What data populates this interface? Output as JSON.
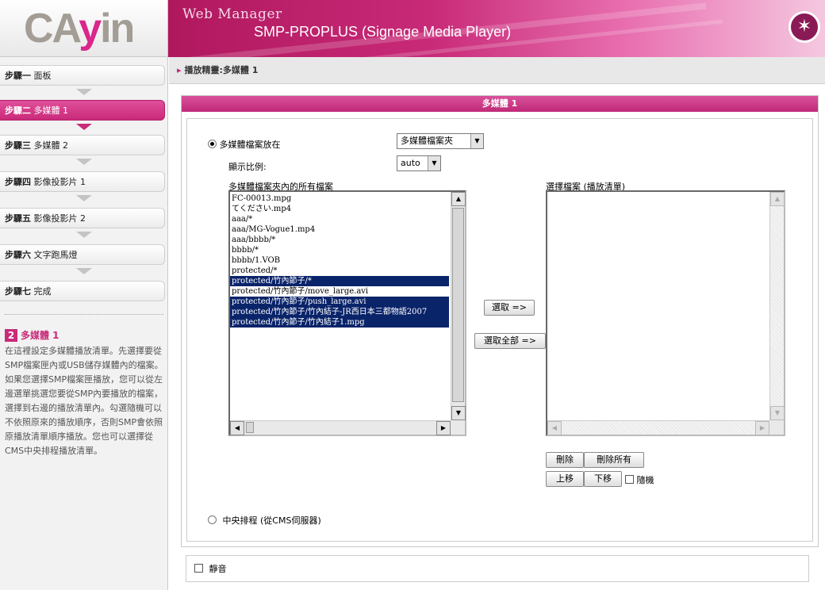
{
  "header": {
    "logo_prefix": "CA",
    "logo_y": "y",
    "logo_suffix": "in",
    "web_manager": "Web Manager",
    "product": "SMP-PROPLUS (Signage Media Player)",
    "corner_icon": "logout-icon",
    "brand_color": "#c92a7a"
  },
  "sidebar": {
    "steps": [
      {
        "num": "步驟一",
        "label": "面板"
      },
      {
        "num": "步驟二",
        "label": "多媒體 1"
      },
      {
        "num": "步驟三",
        "label": "多媒體 2"
      },
      {
        "num": "步驟四",
        "label": "影像投影片 1"
      },
      {
        "num": "步驟五",
        "label": "影像投影片 2"
      },
      {
        "num": "步驟六",
        "label": "文字跑馬燈"
      },
      {
        "num": "步驟七",
        "label": "完成"
      }
    ],
    "help": {
      "num": "2",
      "title": "多媒體 1",
      "text": "在這裡設定多媒體播放清單。先選擇要從SMP檔案匣內或USB儲存媒體內的檔案。如果您選擇SMP檔案匣播放，您可以從左邊選單挑選您要從SMP內要播放的檔案，選擇到右邊的播放清單內。勾選隨機可以不依照原來的播放順序，否則SMP會依照原播放清單順序播放。您也可以選擇從CMS中央排程播放清單。"
    }
  },
  "breadcrumb": "播放精靈:多媒體 1",
  "panel": {
    "title": "多媒體 1",
    "source_label": "多媒體檔案放在",
    "source_value": "多媒體檔案夾",
    "ratio_label": "顯示比例:",
    "ratio_value": "auto",
    "all_files_label": "多媒體檔案夾內的所有檔案",
    "playlist_label": "選擇檔案 (播放清單)",
    "files": [
      {
        "name": "FC-00013.mpg",
        "selected": false
      },
      {
        "name": "てください.mp4",
        "selected": false
      },
      {
        "name": "aaa/*",
        "selected": false
      },
      {
        "name": "aaa/MG-Vogue1.mp4",
        "selected": false
      },
      {
        "name": "aaa/bbbb/*",
        "selected": false
      },
      {
        "name": "bbbb/*",
        "selected": false
      },
      {
        "name": "bbbb/1.VOB",
        "selected": false
      },
      {
        "name": "protected/*",
        "selected": false
      },
      {
        "name": "protected/竹內節子/*",
        "selected": true
      },
      {
        "name": "protected/竹內節子/move_large.avi",
        "selected": false
      },
      {
        "name": "protected/竹內節子/push_large.avi",
        "selected": true
      },
      {
        "name": "protected/竹內節子/竹內結子-JR西日本三都物語2007",
        "selected": true
      },
      {
        "name": "protected/竹內節子/竹內結子1.mpg",
        "selected": true
      }
    ],
    "select_btn": "選取 =>",
    "select_all_btn": "選取全部 =>",
    "delete_btn": "刪除",
    "delete_all_btn": "刪除所有",
    "up_btn": "上移",
    "down_btn": "下移",
    "random_label": "隨機",
    "central_label": "中央排程 (從CMS伺服器)",
    "mute_label": "靜音"
  }
}
